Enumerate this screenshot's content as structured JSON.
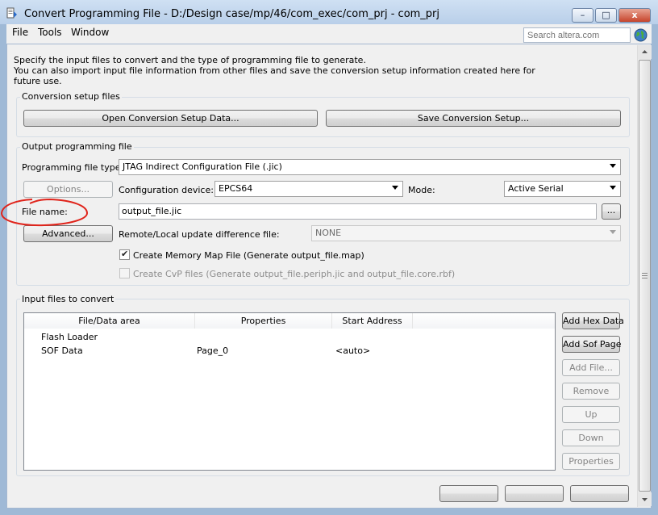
{
  "window": {
    "title": "Convert Programming File - D:/Design case/mp/46/com_exec/com_prj - com_prj",
    "controls": {
      "minimize": "–",
      "maximize": "□",
      "close": "x"
    }
  },
  "menu": {
    "file": "File",
    "tools": "Tools",
    "window": "Window"
  },
  "search": {
    "placeholder": "Search altera.com"
  },
  "intro": {
    "line1": "Specify the input files to convert and the type of programming file to generate.",
    "line2": "You can also import input file information from other files and save the conversion setup information created here for",
    "line3": "future use."
  },
  "conversion_setup": {
    "title": "Conversion setup files",
    "open_button": "Open Conversion Setup Data...",
    "save_button": "Save Conversion Setup..."
  },
  "output": {
    "title": "Output programming file",
    "file_type_label": "Programming file type:",
    "file_type_value": "JTAG Indirect Configuration File (.jic)",
    "options_button": "Options...",
    "config_device_label": "Configuration device:",
    "config_device_value": "EPCS64",
    "mode_label": "Mode:",
    "mode_value": "Active Serial",
    "file_name_label": "File name:",
    "file_name_value": "output_file.jic",
    "browse_button": "...",
    "advanced_button": "Advanced...",
    "remote_label": "Remote/Local update difference file:",
    "remote_value": "NONE",
    "memory_map_label": "Create Memory Map File (Generate output_file.map)",
    "memory_map_checked": true,
    "cvp_label": "Create CvP files (Generate output_file.periph.jic and output_file.core.rbf)",
    "cvp_checked": false
  },
  "input_files": {
    "title": "Input files to convert",
    "columns": [
      "File/Data area",
      "Properties",
      "Start Address"
    ],
    "rows": [
      {
        "name": "Flash Loader",
        "properties": "",
        "start": ""
      },
      {
        "name": "SOF Data",
        "properties": "Page_0",
        "start": "<auto>"
      }
    ],
    "buttons": {
      "add_hex": "Add Hex Data",
      "add_sof": "Add Sof Page",
      "add_file": "Add File...",
      "remove": "Remove",
      "up": "Up",
      "down": "Down",
      "properties": "Properties"
    }
  },
  "colors": {
    "annotation": "#e0241b",
    "titlebar": "#b9cfe9"
  }
}
